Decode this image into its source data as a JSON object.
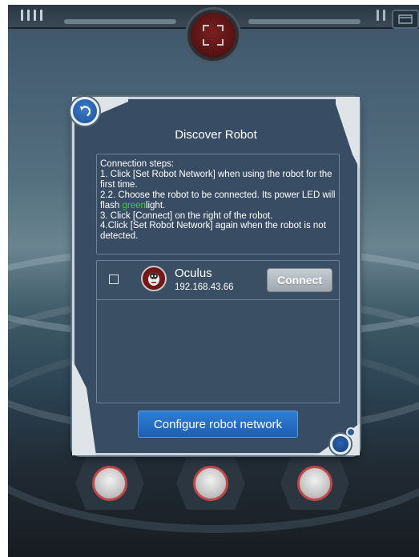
{
  "app": {
    "scan_icon": "scan-frame-icon",
    "window_icon": "window-icon"
  },
  "dialog": {
    "title": "Discover Robot",
    "back_icon": "back-arrow-icon",
    "steps": {
      "heading": "Connection steps:",
      "step1": "1. Click [Set Robot Network] when using the robot for the first time.",
      "step2_pre": "2.2. Choose the robot to be connected. Its power LED will flash ",
      "step2_green": "green",
      "step2_post": "light.",
      "step3": "3. Click [Connect] on the right of the robot.",
      "step4": "4.Click [Set Robot Network] again when the robot is not detected."
    },
    "robots": [
      {
        "name": "Oculus",
        "ip": "192.168.43.66",
        "checked": false,
        "connect_label": "Connect",
        "avatar_icon": "penguin-robot-icon"
      }
    ],
    "configure_label": "Configure robot network"
  },
  "colors": {
    "dialog_bg": "#384d63",
    "accent_blue": "#2f7fd6",
    "led_green": "#35d23a",
    "avatar_red": "#8f2424"
  }
}
